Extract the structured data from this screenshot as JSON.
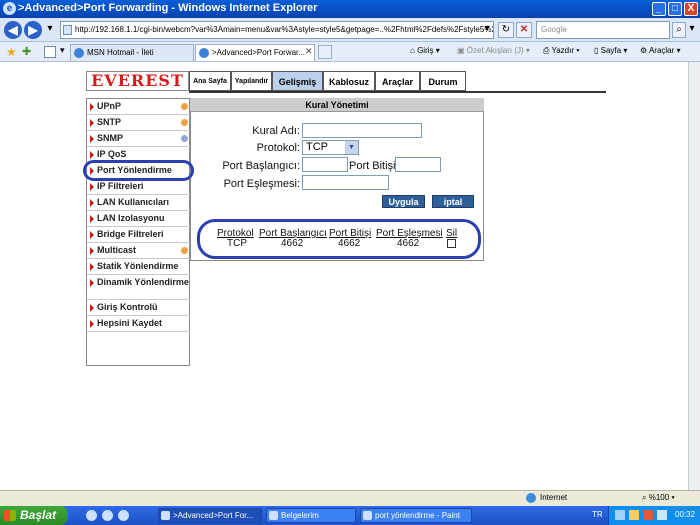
{
  "window": {
    "title": ">Advanced>Port Forwarding - Windows Internet Explorer",
    "minimize": "_",
    "maximize": "□",
    "close": "X"
  },
  "browser": {
    "url": "http://192.168.1.1/cgi-bin/webcm?var%3Amain=menu&var%3Astyle=style5&getpage=..%2Fhtml%2Fdefs%2Fstyle5%2Fi",
    "search_placeholder": "Google",
    "tabs": [
      {
        "label": "MSN Hotmail - İleti"
      },
      {
        "label": ">Advanced>Port Forwar..."
      }
    ],
    "commands": {
      "home": "Giriş",
      "feeds": "Özet Akışları (J)",
      "print": "Yazdır",
      "page": "Sayfa",
      "tools": "Araçlar"
    }
  },
  "router": {
    "logo": "EVEREST",
    "menu": [
      {
        "label": "Ana Sayfa"
      },
      {
        "label": "Yapılandır"
      },
      {
        "label": "Gelişmiş"
      },
      {
        "label": "Kablosuz"
      },
      {
        "label": "Araçlar"
      },
      {
        "label": "Durum"
      }
    ],
    "sidebar": [
      {
        "label": "UPnP"
      },
      {
        "label": "SNTP"
      },
      {
        "label": "SNMP"
      },
      {
        "label": "IP QoS"
      },
      {
        "label": "Port Yönlendirme"
      },
      {
        "label": "IP Filtreleri"
      },
      {
        "label": "LAN Kullanıcıları"
      },
      {
        "label": "LAN Izolasyonu"
      },
      {
        "label": "Bridge Filtreleri"
      },
      {
        "label": "Multicast"
      },
      {
        "label": "Statik Yönlendirme"
      },
      {
        "label": "Dinamik Yönlendirme"
      },
      {
        "label": "Giriş Kontrolü"
      },
      {
        "label": "Hepsini Kaydet"
      }
    ],
    "panel": {
      "title": "Kural Yönetimi",
      "rule_name_label": "Kural Adı:",
      "protocol_label": "Protokol:",
      "protocol_value": "TCP",
      "port_start_label": "Port Başlangıcı:",
      "port_end_label": "Port Bitişi:",
      "port_map_label": "Port Eşleşmesi:",
      "apply_button": "Uygula",
      "cancel_button": "iptal"
    },
    "rules_table": {
      "headers": [
        "Protokol",
        "Port Başlangıcı",
        "Port Bitişi",
        "Port Eşleşmesi",
        "Sil"
      ],
      "rows": [
        {
          "protocol": "TCP",
          "port_start": "4662",
          "port_end": "4662",
          "port_map": "4662"
        }
      ]
    }
  },
  "statusbar": {
    "zone": "Internet",
    "zoom": "%100"
  },
  "taskbar": {
    "start": "Başlat",
    "tasks": [
      {
        "label": ">Advanced>Port For..."
      },
      {
        "label": "Belgelerim"
      },
      {
        "label": "port yönlendirme - Paint"
      }
    ],
    "lang": "TR",
    "clock": "00:32"
  },
  "colors": {
    "annotation_circle": "#2a3fb0",
    "button_blue": "#2f5f98",
    "sidebar_arrow": "#c81818",
    "logo_red": "#d51b1b"
  }
}
